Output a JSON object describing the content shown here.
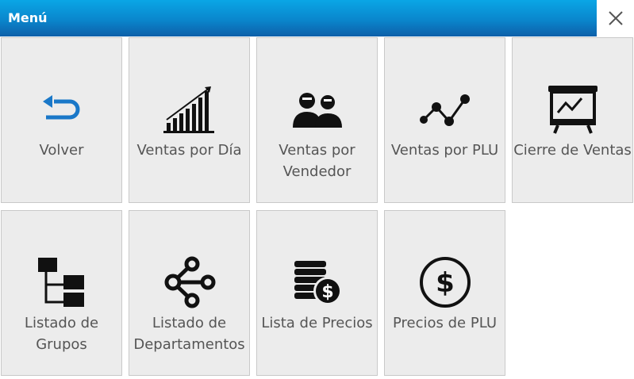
{
  "window": {
    "title": "Menú"
  },
  "tiles": [
    {
      "label": "Volver",
      "icon": "return-arrow-icon"
    },
    {
      "label": "Ventas por Día",
      "icon": "bar-chart-icon"
    },
    {
      "label": "Ventas por\nVendedor",
      "icon": "users-icon"
    },
    {
      "label": "Ventas por PLU",
      "icon": "line-chart-icon"
    },
    {
      "label": "Cierre de Ventas",
      "icon": "presentation-board-icon"
    },
    {
      "label": "Listado de\nGrupos",
      "icon": "tree-structure-icon"
    },
    {
      "label": "Listado de\nDepartamentos",
      "icon": "share-nodes-icon"
    },
    {
      "label": "Lista de Precios",
      "icon": "coins-dollar-icon"
    },
    {
      "label": "Precios de PLU",
      "icon": "dollar-circle-icon"
    }
  ],
  "colors": {
    "titlebar": "#0a86cc",
    "tile": "#ececec",
    "accent": "#1a78c8"
  }
}
